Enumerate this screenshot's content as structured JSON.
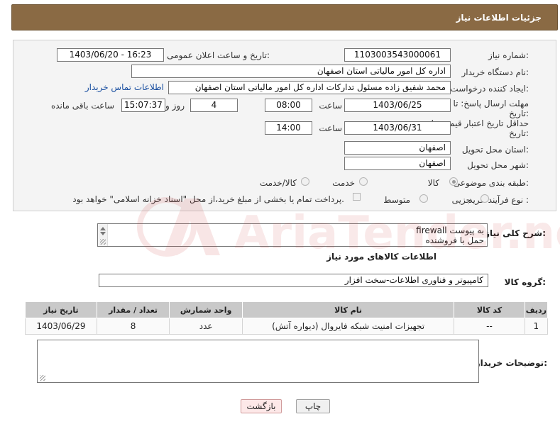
{
  "header": {
    "title": "جزئیات اطلاعات نیاز"
  },
  "form": {
    "need_number_label": "شماره نیاز:",
    "need_number_value": "1103003543000061",
    "announce_label": "تاریخ و ساعت اعلان عمومی:",
    "announce_value": "1403/06/20 - 16:23",
    "buyer_label": "نام دستگاه خریدار:",
    "buyer_value": "اداره کل امور مالیاتی استان اصفهان",
    "creator_label": "ایجاد کننده درخواست:",
    "creator_value": "محمد شفیق زاده مسئول تدارکات اداره کل امور مالیاتی استان اصفهان",
    "contact_link": "اطلاعات تماس خریدار",
    "deadline_label_1": "مهلت ارسال پاسخ: تا",
    "deadline_label_2": "تاریخ:",
    "deadline_date": "1403/06/25",
    "time_label": "ساعت",
    "deadline_time": "08:00",
    "days_value": "4",
    "days_label": "روز و",
    "remaining_value": "15:07:37",
    "remaining_label": "ساعت باقی مانده",
    "validity_label_1": "حداقل تاریخ اعتبار قیمت: تا",
    "validity_label_2": "تاریخ:",
    "validity_date": "1403/06/31",
    "validity_time_label": "ساعت",
    "validity_time": "14:00",
    "province_label": "استان محل تحویل:",
    "province_value": "اصفهان",
    "city_label": "شهر محل تحویل:",
    "city_value": "اصفهان",
    "category_label": "طبقه بندی موضوعی:",
    "category_options": [
      "کالا",
      "خدمت",
      "کالا/خدمت"
    ],
    "process_label": "نوع فرآیند خرید :",
    "process_options": [
      "جزیی",
      "متوسط"
    ],
    "payment_note": "پرداخت تمام یا بخشی از مبلغ خرید،از محل \"اسناد خزانه اسلامی\" خواهد بود."
  },
  "description": {
    "label": "شرح کلی نیاز:",
    "line1": "firewall به پیوست",
    "line2": "حمل با فروشنده"
  },
  "goods": {
    "section_title": "اطلاعات کالاهای مورد نیاز",
    "group_label": "گروه کالا:",
    "group_value": "کامپیوتر و فناوری اطلاعات-سخت افزار",
    "columns": [
      "ردیف",
      "کد کالا",
      "نام کالا",
      "واحد شمارش",
      "تعداد / مقدار",
      "تاریخ نیاز"
    ],
    "rows": [
      {
        "index": "1",
        "code": "--",
        "name": "تجهیزات امنیت شبکه فایروال (دیواره آتش)",
        "unit": "عدد",
        "qty": "8",
        "date": "1403/06/29"
      }
    ]
  },
  "buyer_notes": {
    "label": "توضیحات خریدار:"
  },
  "buttons": {
    "print": "چاپ",
    "back": "بازگشت"
  },
  "watermark": {
    "text": "AriaTender.neT"
  },
  "colors": {
    "header_bg": "#8a6a44",
    "link": "#1a4fa0",
    "table_header": "#c9c9c9"
  }
}
